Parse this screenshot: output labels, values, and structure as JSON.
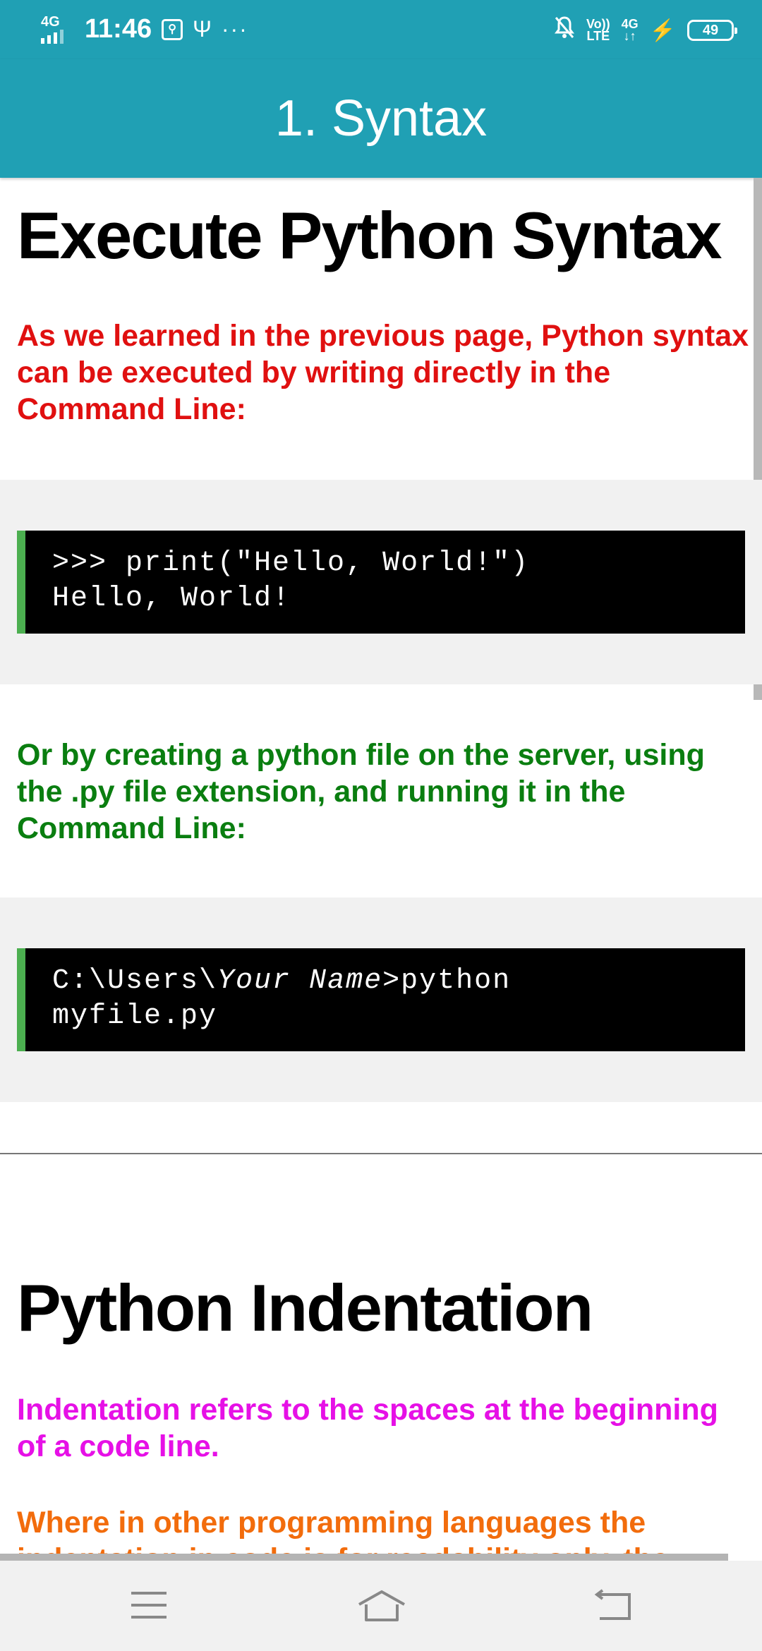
{
  "status_bar": {
    "network": "4G",
    "time": "11:46",
    "usb_debug_icon": "usb-debug-icon",
    "usb_icon": "usb-icon",
    "more": "···",
    "volte_top": "Vo))",
    "volte_bottom": "LTE",
    "net_right_top": "4G",
    "net_right_bottom": "↓↑",
    "battery": "49"
  },
  "app_bar": {
    "title": "1. Syntax"
  },
  "content": {
    "heading1": "Execute Python Syntax",
    "para1": "As we learned in the previous page, Python syntax can be executed by writing directly in the Command Line:",
    "code1": {
      "line1": ">>> print(\"Hello, World!\")",
      "line2": "Hello, World!"
    },
    "para2": "Or by creating a python file on the server, using the .py file extension, and running it in the Command Line:",
    "code2": {
      "prefix": "C:\\Users\\",
      "italic": "Your Name",
      "suffix": ">python",
      "line2": "myfile.py"
    },
    "heading2": "Python Indentation",
    "para3": "Indentation refers to the spaces at the beginning of a code line.",
    "para4": "Where in other programming languages the indentation in code is for readability only, the"
  },
  "colors": {
    "app_bar": "#20a0b4",
    "red_text": "#e01010",
    "green_text": "#0a7e10",
    "magenta_text": "#e610e6",
    "orange_text": "#f26c0c",
    "code_border": "#4caf50"
  },
  "nav_bar": {
    "menu": "menu-icon",
    "home": "home-icon",
    "back": "back-icon"
  }
}
